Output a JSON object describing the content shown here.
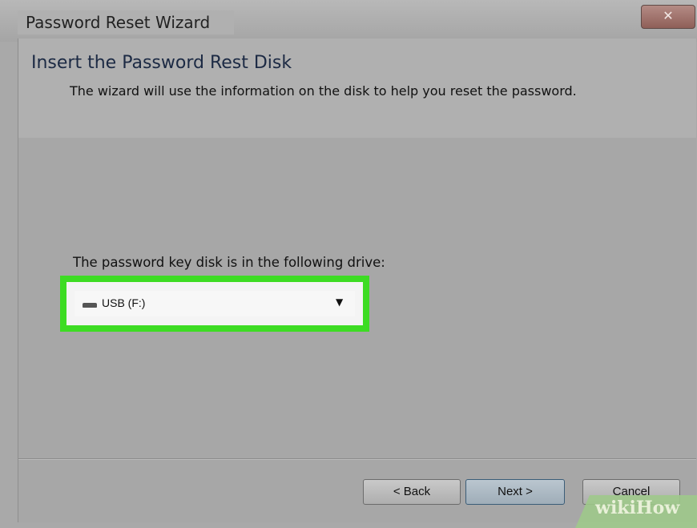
{
  "window": {
    "title": "Password Reset Wizard",
    "close_glyph": "✕"
  },
  "header": {
    "title": "Insert the Password Rest Disk",
    "description": "The wizard will use the information on the disk to help you reset the password."
  },
  "drive_selector": {
    "label": "The password key disk is in the following drive:",
    "selected": "USB (F:)",
    "icon": "usb-drive-icon",
    "highlight_color": "#3ddc23"
  },
  "buttons": {
    "back": "< Back",
    "next": "Next >",
    "cancel": "Cancel"
  },
  "watermark": {
    "text": "wikiHow"
  }
}
